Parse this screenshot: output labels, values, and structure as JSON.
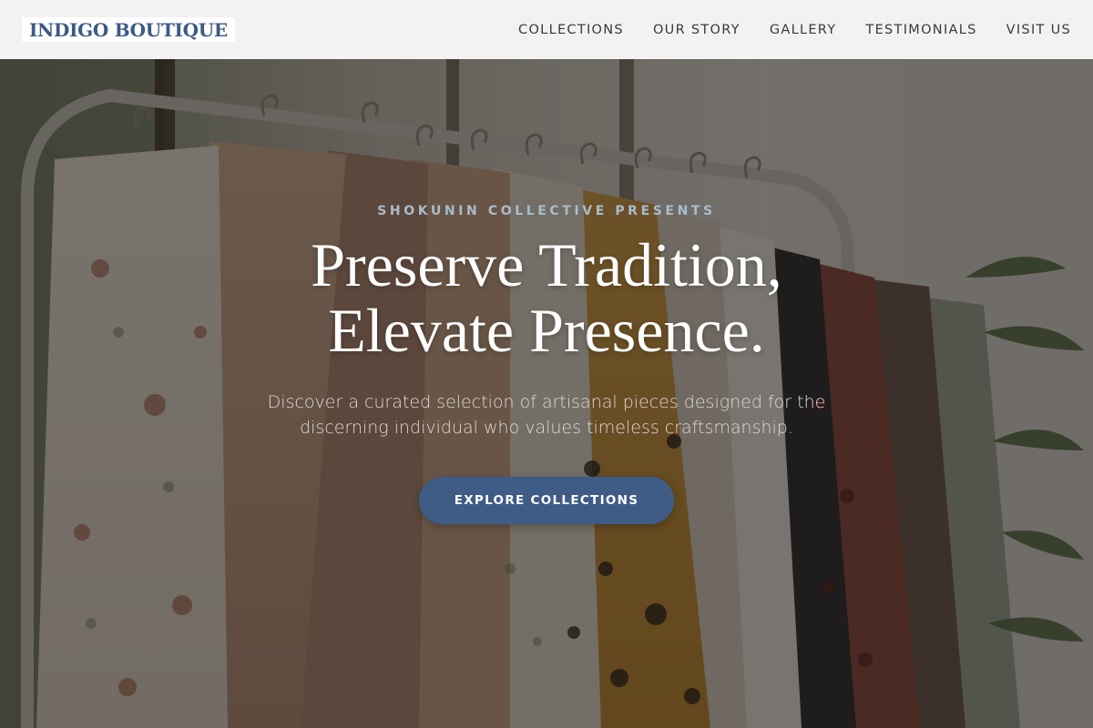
{
  "header": {
    "logo": "INDIGO BOUTIQUE",
    "nav": [
      {
        "label": "COLLECTIONS"
      },
      {
        "label": "OUR STORY"
      },
      {
        "label": "GALLERY"
      },
      {
        "label": "TESTIMONIALS"
      },
      {
        "label": "VISIT US"
      }
    ]
  },
  "hero": {
    "eyebrow": "SHOKUNIN COLLECTIVE PRESENTS",
    "headline": [
      "Preserve Tradition,",
      "Elevate Presence."
    ],
    "subtitle": [
      "Discover a curated selection of artisanal pieces designed for the",
      "discerning individual who values timeless craftsmanship."
    ],
    "cta_label": "EXPLORE COLLECTIONS",
    "background_image": "photo of a clothing rack with shirts on wooden hangers"
  },
  "colors": {
    "brand": "#3c5a85",
    "cta": "#3e5c86",
    "eyebrow": "#a9bccb",
    "header_bg": "#f2f2f2",
    "nav_text": "#3a3a3a"
  }
}
